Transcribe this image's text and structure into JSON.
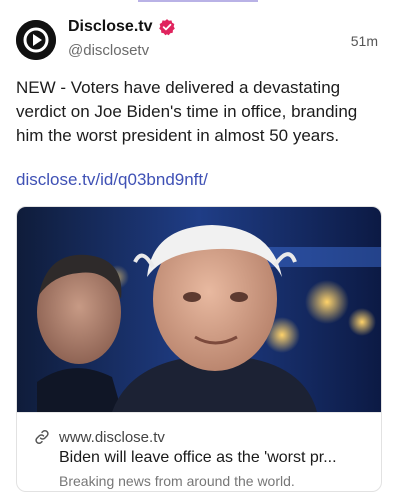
{
  "author": {
    "name": "Disclose.tv",
    "handle": "@disclosetv",
    "verified_color": "#e0245e"
  },
  "post": {
    "time": "51m",
    "text": "NEW - Voters have delivered a devastating verdict on Joe Biden's time in office, branding him the worst president in almost 50 years.",
    "link": "disclose.tv/id/q03bnd9nft/"
  },
  "link_card": {
    "domain": "www.disclose.tv",
    "title": "Biden will leave office as the 'worst pr...",
    "description": "Breaking news from around the world.",
    "image_icon": "news-photo"
  },
  "colors": {
    "link": "#3f51b5",
    "muted": "#6b6b6b"
  }
}
